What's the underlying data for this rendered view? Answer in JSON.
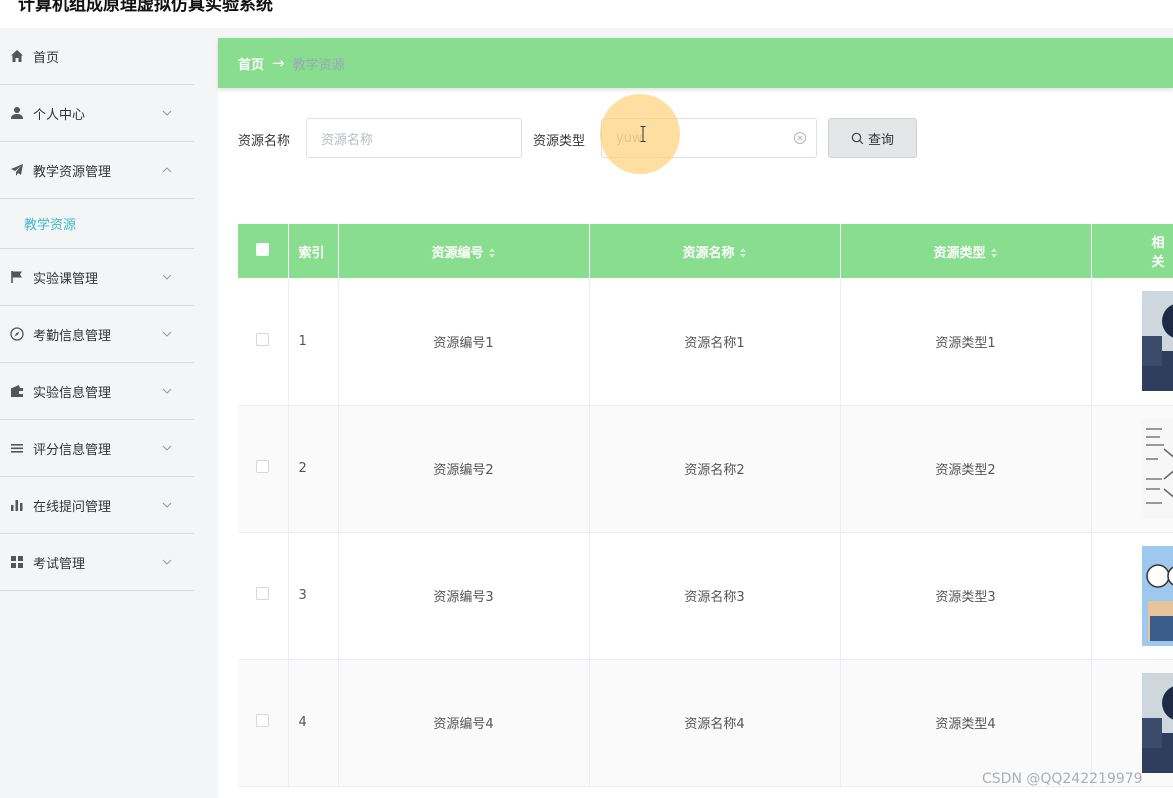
{
  "app": {
    "title": "计算机组成原理虚拟仿真实验系统"
  },
  "sidebar": {
    "items": [
      {
        "label": "首页",
        "icon": "home-icon",
        "chevron": ""
      },
      {
        "label": "个人中心",
        "icon": "user-icon",
        "chevron": "down"
      },
      {
        "label": "教学资源管理",
        "icon": "send-icon",
        "chevron": "up"
      },
      {
        "label": "实验课管理",
        "icon": "flag-icon",
        "chevron": "down"
      },
      {
        "label": "考勤信息管理",
        "icon": "compass-icon",
        "chevron": "down"
      },
      {
        "label": "实验信息管理",
        "icon": "wallet-icon",
        "chevron": "down"
      },
      {
        "label": "评分信息管理",
        "icon": "list-icon",
        "chevron": "down"
      },
      {
        "label": "在线提问管理",
        "icon": "bar-chart-icon",
        "chevron": "down"
      },
      {
        "label": "考试管理",
        "icon": "grid-icon",
        "chevron": "down"
      }
    ],
    "active_sub": "教学资源"
  },
  "breadcrumb": {
    "home": "首页",
    "arrow": "→",
    "current": "教学资源"
  },
  "search": {
    "name_label": "资源名称",
    "name_placeholder": "资源名称",
    "type_label": "资源类型",
    "type_value": "yuw",
    "query_label": "查询"
  },
  "table": {
    "columns": [
      "索引",
      "资源编号",
      "资源名称",
      "资源类型",
      "相关"
    ],
    "rows": [
      {
        "index": "1",
        "code": "资源编号1",
        "name": "资源名称1",
        "type": "资源类型1"
      },
      {
        "index": "2",
        "code": "资源编号2",
        "name": "资源名称2",
        "type": "资源类型2"
      },
      {
        "index": "3",
        "code": "资源编号3",
        "name": "资源名称3",
        "type": "资源类型3"
      },
      {
        "index": "4",
        "code": "资源编号4",
        "name": "资源名称4",
        "type": "资源类型4"
      }
    ]
  },
  "watermark": "CSDN @QQ242219979",
  "colors": {
    "accent_green": "#88dd8e",
    "submenu_teal": "#3fb8c6"
  }
}
